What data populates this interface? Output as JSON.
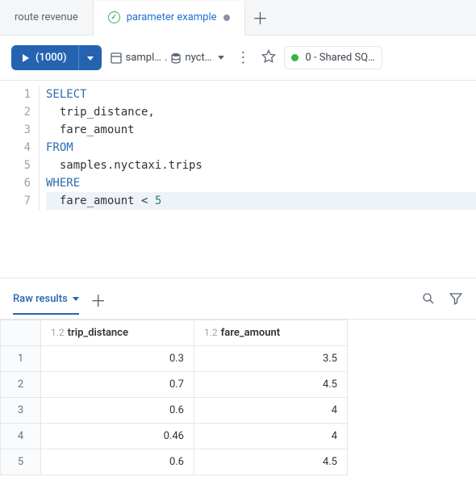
{
  "tabs": {
    "items": [
      {
        "label": "route revenue",
        "active": false
      },
      {
        "label": "parameter example",
        "active": true,
        "dirty": true
      }
    ],
    "add_title": "New tab"
  },
  "toolbar": {
    "run_label": "(1000)",
    "catalog_label": "sampl…",
    "schema_label": "nyct…",
    "cluster_label": "0 - Shared SQ…"
  },
  "editor": {
    "lines": [
      {
        "n": "1",
        "tokens": [
          [
            "SELECT",
            "kw"
          ]
        ]
      },
      {
        "n": "2",
        "tokens": [
          [
            "  trip_distance,",
            ""
          ]
        ]
      },
      {
        "n": "3",
        "tokens": [
          [
            "  fare_amount",
            ""
          ]
        ]
      },
      {
        "n": "4",
        "tokens": [
          [
            "FROM",
            "kw"
          ]
        ]
      },
      {
        "n": "5",
        "tokens": [
          [
            "  samples.nyctaxi.trips",
            ""
          ]
        ]
      },
      {
        "n": "6",
        "tokens": [
          [
            "WHERE",
            "kw"
          ]
        ]
      },
      {
        "n": "7",
        "tokens": [
          [
            "  fare_amount < ",
            ""
          ],
          [
            "5",
            "num"
          ]
        ],
        "hl": true
      }
    ]
  },
  "results": {
    "tab_label": "Raw results",
    "columns": [
      {
        "name": "trip_distance",
        "dtype": "1.2"
      },
      {
        "name": "fare_amount",
        "dtype": "1.2"
      }
    ],
    "rows": [
      {
        "n": "1",
        "v": [
          "0.3",
          "3.5"
        ]
      },
      {
        "n": "2",
        "v": [
          "0.7",
          "4.5"
        ]
      },
      {
        "n": "3",
        "v": [
          "0.6",
          "4"
        ]
      },
      {
        "n": "4",
        "v": [
          "0.46",
          "4"
        ]
      },
      {
        "n": "5",
        "v": [
          "0.6",
          "4.5"
        ]
      }
    ]
  },
  "chart_data": {
    "type": "table",
    "columns": [
      "trip_distance",
      "fare_amount"
    ],
    "values": [
      [
        0.3,
        3.5
      ],
      [
        0.7,
        4.5
      ],
      [
        0.6,
        4.0
      ],
      [
        0.46,
        4.0
      ],
      [
        0.6,
        4.5
      ]
    ]
  }
}
